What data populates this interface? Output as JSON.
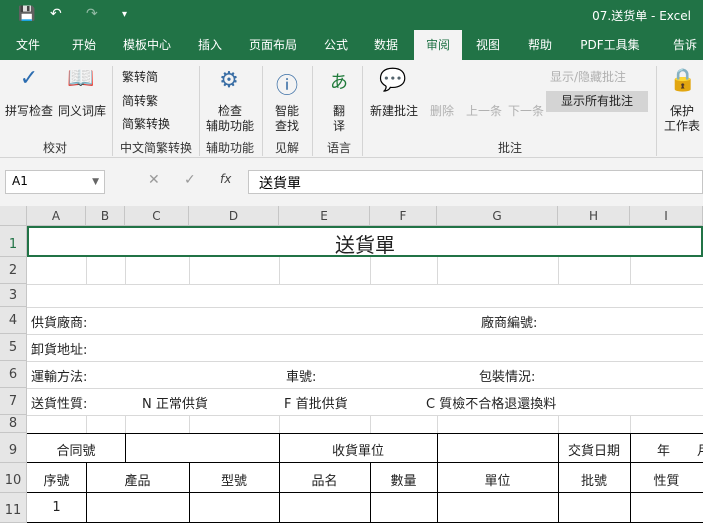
{
  "window": {
    "title": "07.送货单 - Excel"
  },
  "quick_access": {
    "save": "💾",
    "undo": "↶",
    "redo": "↷",
    "more": "▾"
  },
  "tabs": [
    "文件",
    "开始",
    "模板中心",
    "插入",
    "页面布局",
    "公式",
    "数据",
    "审阅",
    "视图",
    "帮助",
    "PDF工具集",
    "告诉"
  ],
  "ribbon": {
    "proofing": {
      "spell": "拼写检查",
      "thesaurus": "同义词库",
      "group": "校对"
    },
    "chinese": {
      "t2s": "繁转简",
      "s2t": "简转繁",
      "convert": "简繁转换",
      "group": "中文简繁转换"
    },
    "accessibility": {
      "check": "检查",
      "check2": "辅助功能",
      "group": "辅助功能"
    },
    "insights": {
      "smart": "智能",
      "smart2": "查找",
      "group": "见解"
    },
    "language": {
      "translate": "翻",
      "translate2": "译",
      "group": "语言"
    },
    "comments": {
      "new": "新建批注",
      "delete": "删除",
      "prev": "上一条",
      "next": "下一条",
      "show_hide": "显示/隐藏批注",
      "show_all": "显示所有批注",
      "group": "批注"
    },
    "protect": {
      "sheet": "保护",
      "sheet2": "工作表"
    }
  },
  "formula_bar": {
    "name_box": "A1",
    "value": "送貨單",
    "fx": "fx"
  },
  "columns": [
    "A",
    "B",
    "C",
    "D",
    "E",
    "F",
    "G",
    "H",
    "I"
  ],
  "rows": [
    "1",
    "2",
    "3",
    "4",
    "5",
    "6",
    "7",
    "8",
    "9",
    "10",
    "11"
  ],
  "sheet": {
    "title": "送貨單",
    "supplier": "供貨廠商:",
    "vendor_no": "廠商編號:",
    "address": "卸貨地址:",
    "transport": "運輸方法:",
    "car_no": "車號:",
    "packing": "包裝情況:",
    "nature": "送貨性質:",
    "n": "N 正常供貨",
    "f": "F  首批供貨",
    "c": "C  質檢不合格退還換料",
    "contract": "合同號",
    "receiver": "收貨單位",
    "delivery_date": "交貨日期",
    "year": "年",
    "month": "月",
    "headers": [
      "序號",
      "產品",
      "型號",
      "品名",
      "數量",
      "單位",
      "批號",
      "性質"
    ],
    "row1_no": "1"
  }
}
